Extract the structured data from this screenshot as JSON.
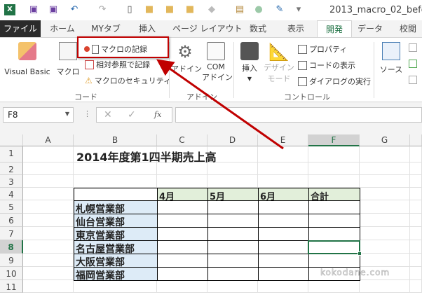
{
  "title_bar": {
    "document_title": "2013_macro_02_befo"
  },
  "tabs": [
    "ファイル",
    "ホーム",
    "MYタブ",
    "挿入",
    "ページ レイアウト",
    "数式",
    "表示",
    "開発",
    "データ",
    "校閲"
  ],
  "active_tab": "開発",
  "ribbon": {
    "code_group": {
      "label": "コード",
      "visual_basic": "Visual Basic",
      "macro": "マクロ",
      "record_macro": "マクロの記録",
      "relative_ref": "相対参照で記録",
      "macro_security": "マクロのセキュリティ"
    },
    "addin_group": {
      "label": "アドイン",
      "addin": "アドイン",
      "com_addin_1": "COM",
      "com_addin_2": "アドイン"
    },
    "controls_group": {
      "label": "コントロール",
      "insert": "挿入",
      "design_mode_1": "デザイン",
      "design_mode_2": "モード",
      "properties": "プロパティ",
      "view_code": "コードの表示",
      "run_dialog": "ダイアログの実行"
    },
    "xml_group": {
      "source": "ソース"
    }
  },
  "formula_bar": {
    "name_box": "F8",
    "fx": "fx",
    "value": ""
  },
  "columns": [
    "A",
    "B",
    "C",
    "D",
    "E",
    "F",
    "G"
  ],
  "selected_column": "F",
  "rows": [
    "1",
    "2",
    "3",
    "4",
    "5",
    "6",
    "7",
    "8",
    "9",
    "10",
    "11"
  ],
  "selected_row": "8",
  "sheet": {
    "title": "2014年度第1四半期売上高",
    "headers": [
      "4月",
      "5月",
      "6月",
      "合計"
    ],
    "branches": [
      "札幌営業部",
      "仙台営業部",
      "東京営業部",
      "名古屋営業部",
      "大阪営業部",
      "福岡営業部"
    ]
  },
  "watermark": "kokodane.com",
  "colors": {
    "accent": "#217346",
    "highlight": "#c00000",
    "header_fill": "#e2efda",
    "branch_fill": "#ddebf7"
  }
}
